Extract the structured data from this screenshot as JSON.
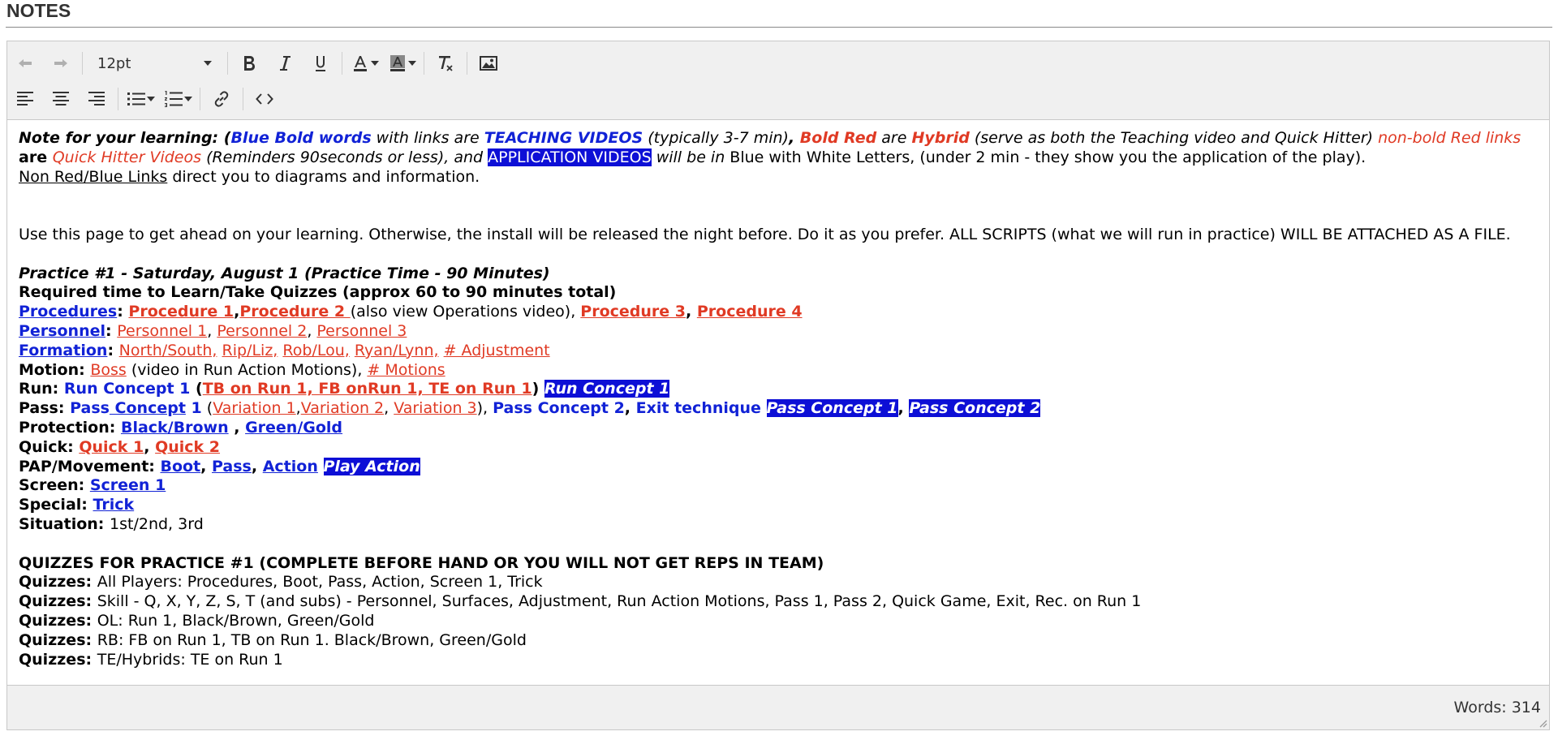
{
  "header": {
    "title": "NOTES"
  },
  "toolbar": {
    "font_size": "12pt"
  },
  "editor": {
    "legend": {
      "a": "Note for your learning: (",
      "b": "Blue Bold words",
      "c": " with links are ",
      "d": "TEACHING VIDEOS",
      "e": " (typically 3-7 min)",
      "f": ", ",
      "g": "Bold Red",
      "h": " are ",
      "i": "Hybrid",
      "j": " (serve as both the Teaching video and Quick Hitter) ",
      "k": "non-bold Red links",
      "l": " are ",
      "m": "Quick Hitter Videos",
      "n": " (Reminders 90seconds or less), and ",
      "o": "APPLICATION VIDEOS",
      "p": " will be in ",
      "q": "Blue with White Letters, (under 2 min - they show you the application of the play).",
      "r": "Non Red/Blue Links",
      "s": " direct you to diagrams and information."
    },
    "intro": "Use this page to get ahead on your learning. Otherwise, the install will be released the night before. Do it as you prefer. ALL SCRIPTS (what we will run in practice) WILL BE ATTACHED AS A FILE.",
    "practice_title": "Practice #1 - Saturday, August 1 (Practice Time - 90 Minutes)",
    "required_time": "Required time to Learn/Take Quizzes (approx 60 to 90 minutes total)",
    "procedures": {
      "label": "Procedures",
      "colon": ": ",
      "p1": "Procedure 1",
      "comma": ",",
      "p2": "Procedure 2 ",
      "note": "(also view Operations video), ",
      "p3": "Procedure 3",
      "sep": ", ",
      "p4": "Procedure 4"
    },
    "personnel": {
      "label": "Personnel",
      "colon": ": ",
      "p1": "Personnel 1",
      "sep1": ", ",
      "p2": "Personnel 2",
      "sep2": ", ",
      "p3": "Personnel 3"
    },
    "formation": {
      "label": "Formation",
      "colon": ": ",
      "f1": "North/South,",
      "f2": "Rip/Liz,",
      "f3": "Rob/Lou,",
      "f4": "Ryan/Lynn,",
      "f5": "# Adjustment"
    },
    "motion": {
      "label": "Motion: ",
      "boss": "Boss",
      "note": " (video in Run Action Motions), ",
      "motions": "# Motions"
    },
    "run": {
      "label": "Run: ",
      "concept": "Run Concept 1",
      "open": " (",
      "links": "TB on Run 1, FB onRun 1, TE on Run 1",
      "close": ") ",
      "app": "Run Concept 1"
    },
    "pass": {
      "label": "Pass: ",
      "pass_word": "Pass",
      "concept_word": " Concept",
      "one": " 1",
      "open": " (",
      "v1": "Variation 1",
      "c1": ",",
      "v2": "Variation 2",
      "c2": ", ",
      "v3": "Variation 3",
      "close": "), ",
      "concept2": "Pass Concept 2",
      "c3": ", ",
      "exit": "Exit technique",
      "sp": " ",
      "app1": "Pass Concept 1",
      "c4": ", ",
      "app2": "Pass Concept 2"
    },
    "protection": {
      "label": "Protection: ",
      "l1": "Black/Brown",
      "sep": " , ",
      "l2": "Green/Gold"
    },
    "quick": {
      "label": "Quick: ",
      "q1": "Quick 1",
      "sep": ", ",
      "q2": "Quick 2"
    },
    "pap": {
      "label": "PAP/Movement: ",
      "boot": "Boot",
      "s1": ", ",
      "pass": "Pass",
      "s2": ", ",
      "action": "Action",
      "sp": " ",
      "app": "Play Action"
    },
    "screen": {
      "label": "Screen: ",
      "link": "Screen 1"
    },
    "special": {
      "label": "Special: ",
      "link": "Trick"
    },
    "situation": {
      "label": "Situation: ",
      "value": "1st/2nd, 3rd"
    },
    "quizzes_title": "QUIZZES FOR PRACTICE #1 (COMPLETE BEFORE HAND OR YOU WILL NOT GET REPS IN TEAM)",
    "quizzes": [
      {
        "label": "Quizzes: ",
        "text": "All Players: Procedures, Boot, Pass, Action, Screen 1, Trick"
      },
      {
        "label": "Quizzes: ",
        "text": "Skill - Q, X, Y, Z, S, T (and subs) - Personnel, Surfaces, Adjustment, Run Action Motions, Pass 1, Pass 2, Quick Game, Exit, Rec. on Run 1"
      },
      {
        "label": "Quizzes: ",
        "text": "OL: Run 1, Black/Brown, Green/Gold"
      },
      {
        "label": "Quizzes: ",
        "text": "RB: FB on Run 1, TB on Run 1. Black/Brown, Green/Gold"
      },
      {
        "label": "Quizzes: ",
        "text": "TE/Hybrids: TE on Run 1"
      }
    ]
  },
  "status": {
    "word_count": "Words: 314"
  },
  "colors": {
    "blue": "#1122d6",
    "red": "#e03a24",
    "highlight": "#0d0fd6"
  }
}
